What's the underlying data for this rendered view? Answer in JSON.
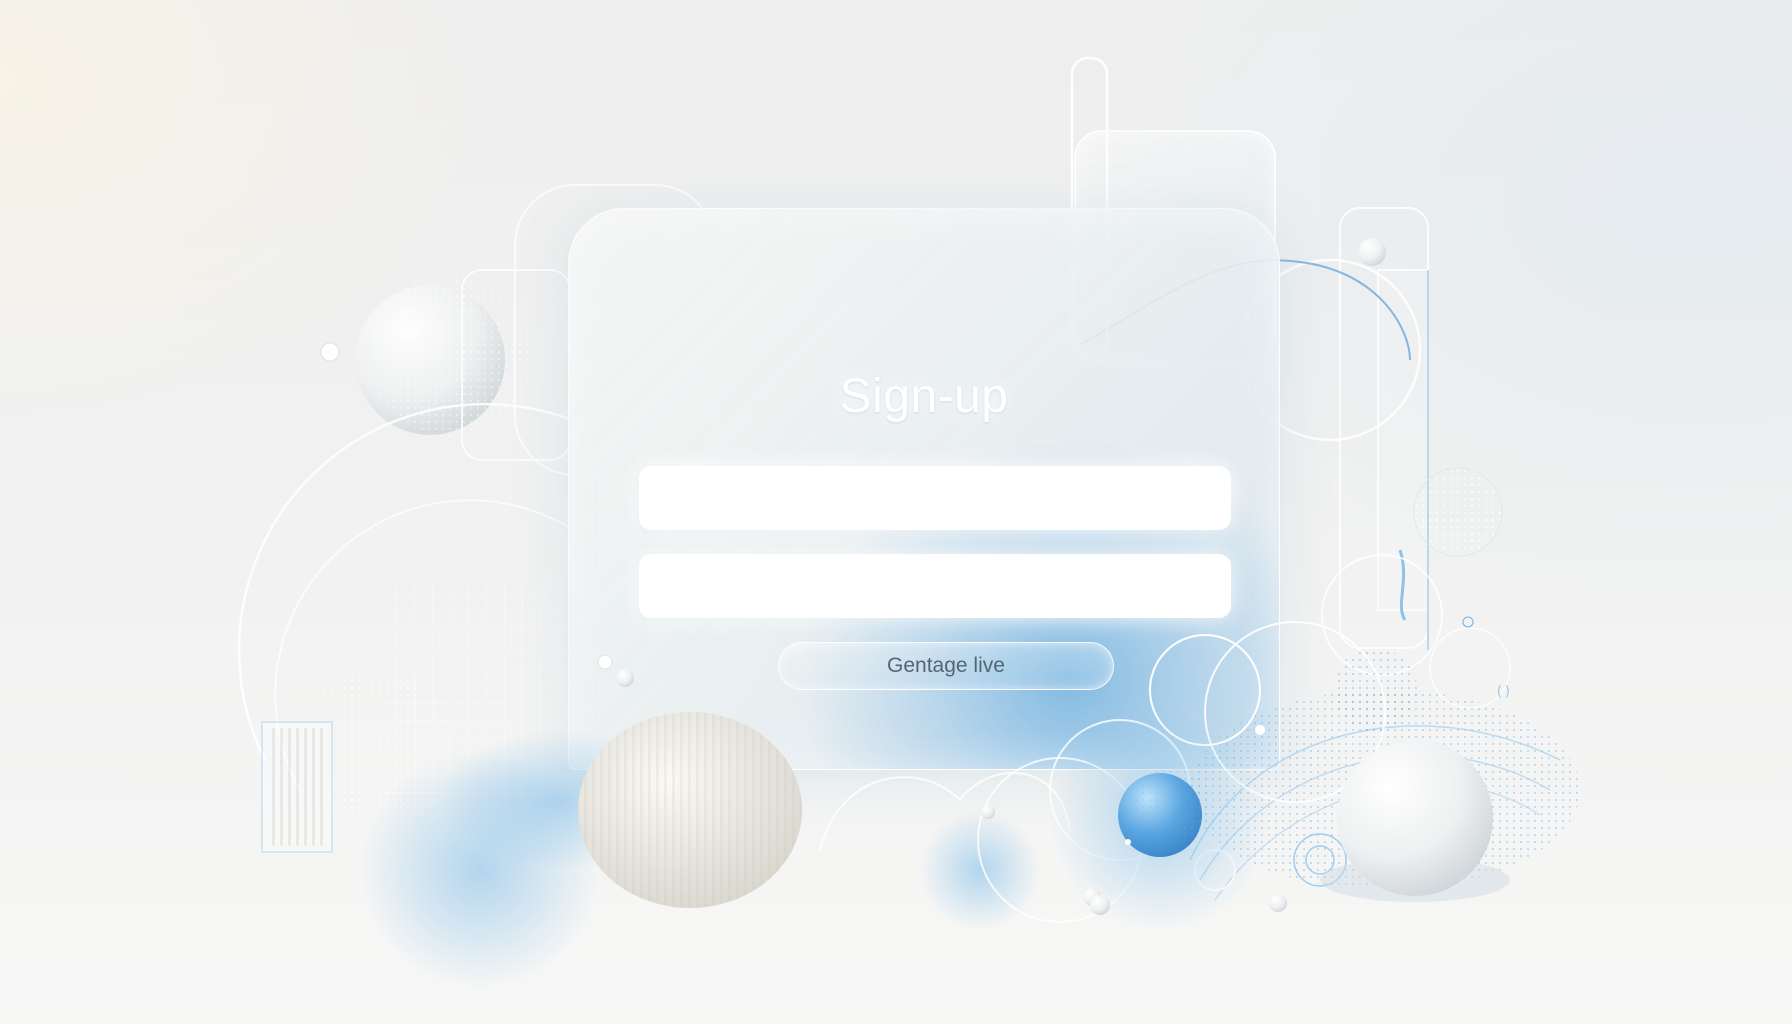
{
  "form": {
    "title": "Sign-up",
    "field_1_value": "",
    "field_2_value": "",
    "submit_label": "Gentage live"
  },
  "colors": {
    "accent": "#5faae0",
    "accent_light": "#a9d2ef",
    "card_text": "#ffffff",
    "button_text": "#556575",
    "background": "#efefed"
  }
}
